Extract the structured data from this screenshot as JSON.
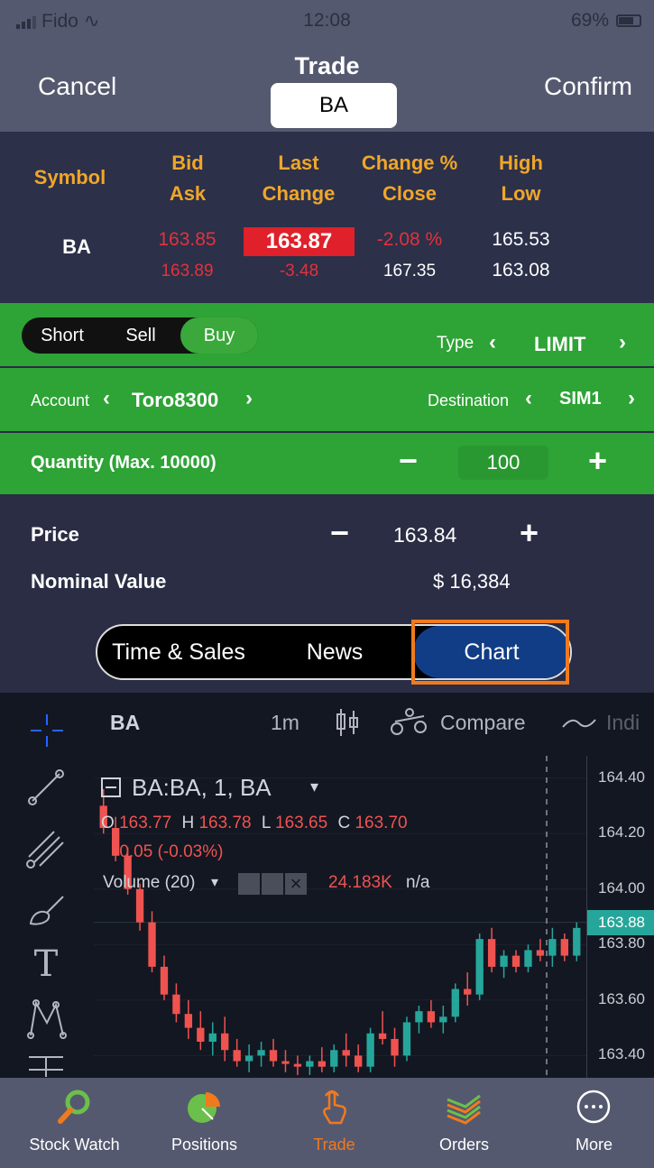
{
  "status": {
    "carrier": "Fido",
    "time": "12:08",
    "battery": "69%"
  },
  "header": {
    "cancel": "Cancel",
    "title": "Trade",
    "symbol_input": "BA",
    "confirm": "Confirm"
  },
  "quote": {
    "headers": {
      "symbol": "Symbol",
      "bid": "Bid",
      "ask": "Ask",
      "last": "Last",
      "change": "Change",
      "change_pct": "Change %",
      "close": "Close",
      "high": "High",
      "low": "Low"
    },
    "symbol": "BA",
    "bid": "163.85",
    "ask": "163.89",
    "last": "163.87",
    "change": "-3.48",
    "change_pct": "-2.08 %",
    "close": "167.35",
    "high": "165.53",
    "low": "163.08"
  },
  "order": {
    "sides": [
      "Short",
      "Sell",
      "Buy"
    ],
    "selected_side": "Buy",
    "type_label": "Type",
    "type_value": "LIMIT",
    "account_label": "Account",
    "account_value": "Toro8300",
    "destination_label": "Destination",
    "destination_value": "SIM1",
    "quantity_label": "Quantity (Max. 10000)",
    "quantity_value": "100",
    "price_label": "Price",
    "price_value": "163.84",
    "nominal_label": "Nominal Value",
    "nominal_value": "$ 16,384"
  },
  "tabs": {
    "items": [
      "Time & Sales",
      "News",
      "Chart"
    ],
    "active": "Chart"
  },
  "chart": {
    "symbol": "BA",
    "interval": "1m",
    "compare": "Compare",
    "indicators": "Indi",
    "title": "BA:BA, 1, BA",
    "ohlc": {
      "o_label": "O",
      "o": "163.77",
      "h_label": "H",
      "h": "163.78",
      "l_label": "L",
      "l": "163.65",
      "c_label": "C",
      "c": "163.70"
    },
    "change_line": "-0.05 (-0.03%)",
    "volume_label": "Volume (20)",
    "volume_value": "24.183K",
    "volume_na": "n/a",
    "axis_ticks": [
      "164.40",
      "164.20",
      "164.00",
      "163.80",
      "163.60",
      "163.40"
    ],
    "current_price": "163.88",
    "colors": {
      "up": "#26a69a",
      "down": "#ef5350"
    }
  },
  "chart_data": {
    "type": "candlestick",
    "ylim": [
      163.32,
      164.48
    ],
    "candles": [
      [
        164.3,
        164.36,
        164.2,
        164.22
      ],
      [
        164.22,
        164.26,
        164.1,
        164.12
      ],
      [
        164.12,
        164.15,
        163.98,
        164.0
      ],
      [
        164.0,
        164.02,
        163.85,
        163.88
      ],
      [
        163.88,
        163.92,
        163.7,
        163.72
      ],
      [
        163.72,
        163.76,
        163.6,
        163.62
      ],
      [
        163.62,
        163.66,
        163.52,
        163.55
      ],
      [
        163.55,
        163.6,
        163.46,
        163.5
      ],
      [
        163.5,
        163.56,
        163.42,
        163.45
      ],
      [
        163.45,
        163.52,
        163.4,
        163.48
      ],
      [
        163.48,
        163.54,
        163.38,
        163.42
      ],
      [
        163.42,
        163.46,
        163.36,
        163.38
      ],
      [
        163.38,
        163.44,
        163.34,
        163.4
      ],
      [
        163.4,
        163.45,
        163.36,
        163.42
      ],
      [
        163.42,
        163.46,
        163.36,
        163.38
      ],
      [
        163.38,
        163.42,
        163.34,
        163.37
      ],
      [
        163.37,
        163.4,
        163.33,
        163.36
      ],
      [
        163.36,
        163.4,
        163.33,
        163.38
      ],
      [
        163.38,
        163.43,
        163.34,
        163.36
      ],
      [
        163.36,
        163.44,
        163.34,
        163.42
      ],
      [
        163.42,
        163.48,
        163.36,
        163.4
      ],
      [
        163.4,
        163.44,
        163.34,
        163.36
      ],
      [
        163.36,
        163.5,
        163.34,
        163.48
      ],
      [
        163.48,
        163.56,
        163.44,
        163.46
      ],
      [
        163.46,
        163.5,
        163.36,
        163.4
      ],
      [
        163.4,
        163.54,
        163.38,
        163.52
      ],
      [
        163.52,
        163.58,
        163.48,
        163.56
      ],
      [
        163.56,
        163.6,
        163.5,
        163.52
      ],
      [
        163.52,
        163.58,
        163.48,
        163.54
      ],
      [
        163.54,
        163.66,
        163.52,
        163.64
      ],
      [
        163.64,
        163.7,
        163.58,
        163.62
      ],
      [
        163.62,
        163.84,
        163.6,
        163.82
      ],
      [
        163.82,
        163.86,
        163.7,
        163.72
      ],
      [
        163.72,
        163.78,
        163.68,
        163.76
      ],
      [
        163.76,
        163.78,
        163.7,
        163.72
      ],
      [
        163.72,
        163.8,
        163.7,
        163.78
      ],
      [
        163.78,
        163.82,
        163.74,
        163.76
      ],
      [
        163.76,
        163.86,
        163.72,
        163.82
      ],
      [
        163.82,
        163.84,
        163.74,
        163.76
      ],
      [
        163.76,
        163.88,
        163.74,
        163.86
      ]
    ]
  },
  "nav": {
    "items": [
      "Stock Watch",
      "Positions",
      "Trade",
      "Orders",
      "More"
    ],
    "active": "Trade"
  }
}
